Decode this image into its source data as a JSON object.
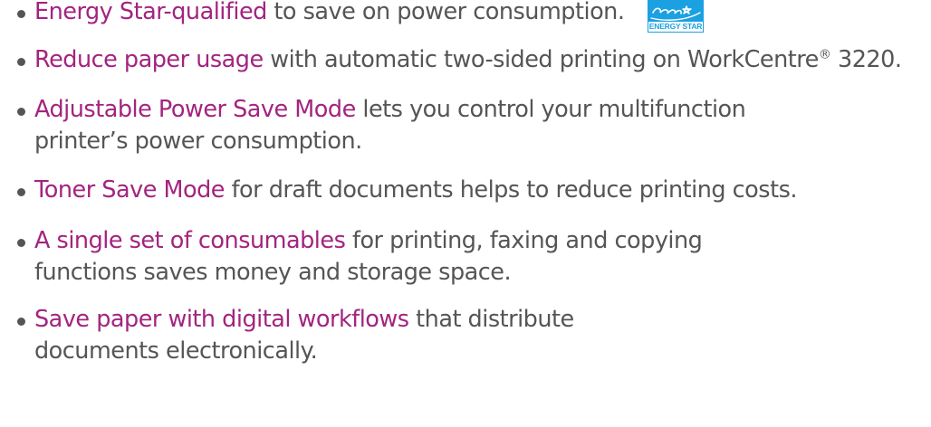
{
  "colors": {
    "text": "#555555",
    "highlight": "#a3247f",
    "energy_star_blue": "#1ba1e2"
  },
  "items": [
    {
      "highlight": "Energy Star-qualified",
      "rest": " to save on power consumption.",
      "line2": ""
    },
    {
      "highlight": "Reduce paper usage",
      "rest": " with automatic two-sided printing on WorkCentre",
      "reg": "®",
      "rest2": " 3220.",
      "line2": ""
    },
    {
      "highlight": "Adjustable Power Save Mode",
      "rest": " lets you control your multifunction",
      "line2": "printer’s power consumption."
    },
    {
      "highlight": "Toner Save Mode",
      "rest": " for draft documents helps to reduce printing costs.",
      "line2": ""
    },
    {
      "highlight": "A single set of consumables",
      "rest": " for printing, faxing and copying",
      "line2": "functions saves money and storage space."
    },
    {
      "highlight": "Save paper with digital workflows",
      "rest": " that distribute",
      "line2": "documents electronically."
    }
  ],
  "energy_star_logo": {
    "label": "ENERGY STAR",
    "script_text": "energy",
    "icon": "energy-star-logo-icon"
  }
}
